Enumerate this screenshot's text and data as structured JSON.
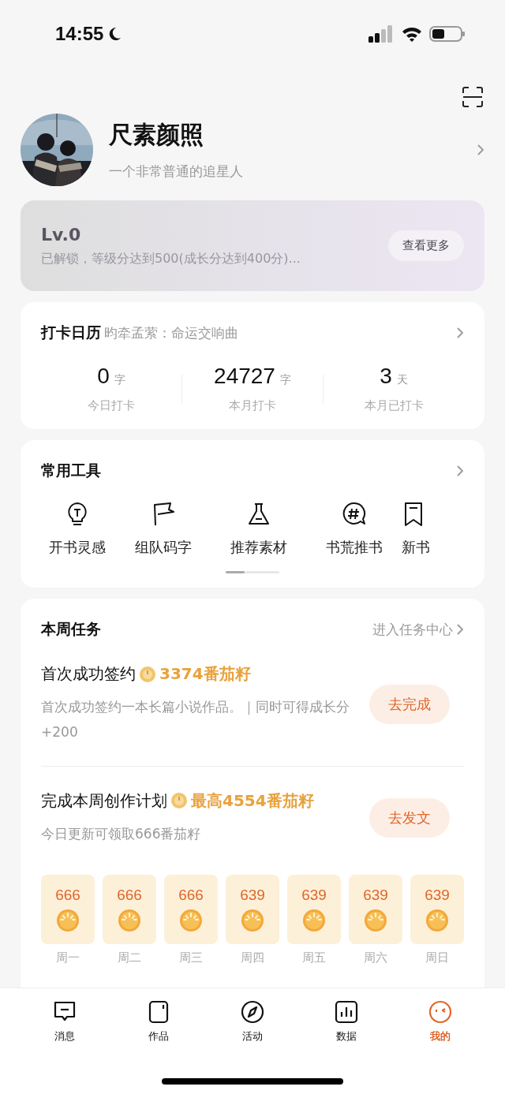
{
  "status_bar": {
    "time": "14:55"
  },
  "profile": {
    "name": "尺素颜照",
    "bio": "一个非常普通的追星人"
  },
  "level_card": {
    "level": "Lv.0",
    "desc": "已解锁，等级分达到500(成长分达到400分)...",
    "button": "查看更多"
  },
  "checkin": {
    "title": "打卡日历",
    "subtitle": "昀牵孟萦：命运交响曲",
    "stats": [
      {
        "value": "0",
        "unit": "字",
        "label": "今日打卡"
      },
      {
        "value": "24727",
        "unit": "字",
        "label": "本月打卡"
      },
      {
        "value": "3",
        "unit": "天",
        "label": "本月已打卡"
      }
    ]
  },
  "tools": {
    "title": "常用工具",
    "items": [
      {
        "kind": "bulb",
        "label": "开书灵感"
      },
      {
        "kind": "flag",
        "label": "组队码字"
      },
      {
        "kind": "flask",
        "label": "推荐素材"
      },
      {
        "kind": "hash",
        "label": "书荒推书"
      },
      {
        "kind": "bookmark",
        "label": "新书"
      }
    ]
  },
  "tasks": {
    "title": "本周任务",
    "link": "进入任务中心",
    "items": [
      {
        "title": "首次成功签约",
        "reward": "3374番茄籽",
        "desc": "首次成功签约一本长篇小说作品。｜同时可得成长分+200",
        "button": "去完成"
      },
      {
        "title": "完成本周创作计划",
        "reward": "最高4554番茄籽",
        "desc": "今日更新可领取666番茄籽",
        "button": "去发文"
      }
    ],
    "days": [
      {
        "amount": "666",
        "label": "周一"
      },
      {
        "amount": "666",
        "label": "周二"
      },
      {
        "amount": "666",
        "label": "周三"
      },
      {
        "amount": "639",
        "label": "周四"
      },
      {
        "amount": "639",
        "label": "周五"
      },
      {
        "amount": "639",
        "label": "周六"
      },
      {
        "amount": "639",
        "label": "周日"
      }
    ]
  },
  "tab_bar": [
    {
      "kind": "message",
      "label": "消息",
      "selected": false
    },
    {
      "kind": "works",
      "label": "作品",
      "selected": false
    },
    {
      "kind": "compass",
      "label": "活动",
      "selected": false
    },
    {
      "kind": "chart",
      "label": "数据",
      "selected": false
    },
    {
      "kind": "face",
      "label": "我的",
      "selected": true
    }
  ]
}
